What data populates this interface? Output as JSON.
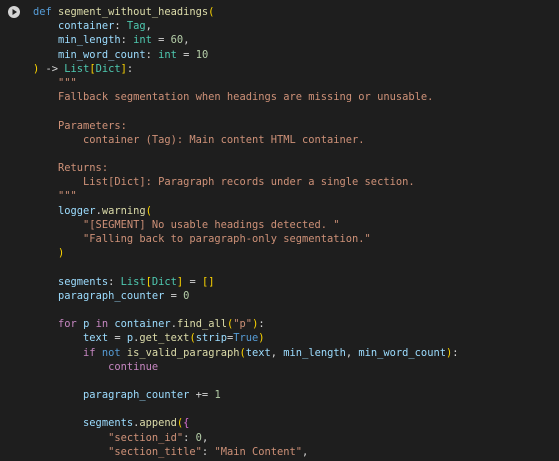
{
  "run_button": {
    "icon": "play-icon"
  },
  "code_lines": [
    [
      {
        "t": "def ",
        "c": "kw"
      },
      {
        "t": "segment_without_headings",
        "c": "fn"
      },
      {
        "t": "(",
        "c": "br1"
      }
    ],
    [
      {
        "t": "    "
      },
      {
        "t": "container",
        "c": "var"
      },
      {
        "t": ": "
      },
      {
        "t": "Tag",
        "c": "typ"
      },
      {
        "t": ","
      }
    ],
    [
      {
        "t": "    "
      },
      {
        "t": "min_length",
        "c": "var"
      },
      {
        "t": ": "
      },
      {
        "t": "int",
        "c": "typ"
      },
      {
        "t": " = "
      },
      {
        "t": "60",
        "c": "num"
      },
      {
        "t": ","
      }
    ],
    [
      {
        "t": "    "
      },
      {
        "t": "min_word_count",
        "c": "var"
      },
      {
        "t": ": "
      },
      {
        "t": "int",
        "c": "typ"
      },
      {
        "t": " = "
      },
      {
        "t": "10",
        "c": "num"
      }
    ],
    [
      {
        "t": ")",
        "c": "br1"
      },
      {
        "t": " -> "
      },
      {
        "t": "List",
        "c": "typ"
      },
      {
        "t": "[",
        "c": "br1"
      },
      {
        "t": "Dict",
        "c": "typ"
      },
      {
        "t": "]",
        "c": "br1"
      },
      {
        "t": ":"
      }
    ],
    [
      {
        "t": "    \"\"\"",
        "c": "str"
      }
    ],
    [
      {
        "t": "    Fallback segmentation when headings are missing or unusable.",
        "c": "str"
      }
    ],
    [
      {
        "t": ""
      }
    ],
    [
      {
        "t": "    Parameters:",
        "c": "str"
      }
    ],
    [
      {
        "t": "        container (Tag): Main content HTML container.",
        "c": "str"
      }
    ],
    [
      {
        "t": ""
      }
    ],
    [
      {
        "t": "    Returns:",
        "c": "str"
      }
    ],
    [
      {
        "t": "        List[Dict]: Paragraph records under a single section.",
        "c": "str"
      }
    ],
    [
      {
        "t": "    \"\"\"",
        "c": "str"
      }
    ],
    [
      {
        "t": "    "
      },
      {
        "t": "logger",
        "c": "var"
      },
      {
        "t": "."
      },
      {
        "t": "warning",
        "c": "fn"
      },
      {
        "t": "(",
        "c": "br1"
      }
    ],
    [
      {
        "t": "        \"[SEGMENT] No usable headings detected. \"",
        "c": "str"
      }
    ],
    [
      {
        "t": "        \"Falling back to paragraph-only segmentation.\"",
        "c": "str"
      }
    ],
    [
      {
        "t": "    "
      },
      {
        "t": ")",
        "c": "br1"
      }
    ],
    [
      {
        "t": ""
      }
    ],
    [
      {
        "t": "    "
      },
      {
        "t": "segments",
        "c": "var"
      },
      {
        "t": ": "
      },
      {
        "t": "List",
        "c": "typ"
      },
      {
        "t": "[",
        "c": "br1"
      },
      {
        "t": "Dict",
        "c": "typ"
      },
      {
        "t": "]",
        "c": "br1"
      },
      {
        "t": " = "
      },
      {
        "t": "[]",
        "c": "br1"
      }
    ],
    [
      {
        "t": "    "
      },
      {
        "t": "paragraph_counter",
        "c": "var"
      },
      {
        "t": " = "
      },
      {
        "t": "0",
        "c": "num"
      }
    ],
    [
      {
        "t": ""
      }
    ],
    [
      {
        "t": "    "
      },
      {
        "t": "for",
        "c": "kwc"
      },
      {
        "t": " "
      },
      {
        "t": "p",
        "c": "var"
      },
      {
        "t": " "
      },
      {
        "t": "in",
        "c": "kwc"
      },
      {
        "t": " "
      },
      {
        "t": "container",
        "c": "var"
      },
      {
        "t": "."
      },
      {
        "t": "find_all",
        "c": "fn"
      },
      {
        "t": "(",
        "c": "br1"
      },
      {
        "t": "\"p\"",
        "c": "str"
      },
      {
        "t": ")",
        "c": "br1"
      },
      {
        "t": ":"
      }
    ],
    [
      {
        "t": "        "
      },
      {
        "t": "text",
        "c": "var"
      },
      {
        "t": " = "
      },
      {
        "t": "p",
        "c": "var"
      },
      {
        "t": "."
      },
      {
        "t": "get_text",
        "c": "fn"
      },
      {
        "t": "(",
        "c": "br1"
      },
      {
        "t": "strip",
        "c": "var"
      },
      {
        "t": "="
      },
      {
        "t": "True",
        "c": "kw"
      },
      {
        "t": ")",
        "c": "br1"
      }
    ],
    [
      {
        "t": "        "
      },
      {
        "t": "if",
        "c": "kwc"
      },
      {
        "t": " "
      },
      {
        "t": "not",
        "c": "kw"
      },
      {
        "t": " "
      },
      {
        "t": "is_valid_paragraph",
        "c": "fn"
      },
      {
        "t": "(",
        "c": "br1"
      },
      {
        "t": "text",
        "c": "var"
      },
      {
        "t": ", "
      },
      {
        "t": "min_length",
        "c": "var"
      },
      {
        "t": ", "
      },
      {
        "t": "min_word_count",
        "c": "var"
      },
      {
        "t": ")",
        "c": "br1"
      },
      {
        "t": ":"
      }
    ],
    [
      {
        "t": "            "
      },
      {
        "t": "continue",
        "c": "kwc"
      }
    ],
    [
      {
        "t": ""
      }
    ],
    [
      {
        "t": "        "
      },
      {
        "t": "paragraph_counter",
        "c": "var"
      },
      {
        "t": " += "
      },
      {
        "t": "1",
        "c": "num"
      }
    ],
    [
      {
        "t": ""
      }
    ],
    [
      {
        "t": "        "
      },
      {
        "t": "segments",
        "c": "var"
      },
      {
        "t": "."
      },
      {
        "t": "append",
        "c": "fn"
      },
      {
        "t": "(",
        "c": "br1"
      },
      {
        "t": "{",
        "c": "br2"
      }
    ],
    [
      {
        "t": "            "
      },
      {
        "t": "\"section_id\"",
        "c": "str"
      },
      {
        "t": ": "
      },
      {
        "t": "0",
        "c": "num"
      },
      {
        "t": ","
      }
    ],
    [
      {
        "t": "            "
      },
      {
        "t": "\"section_title\"",
        "c": "str"
      },
      {
        "t": ": "
      },
      {
        "t": "\"Main Content\"",
        "c": "str"
      },
      {
        "t": ","
      }
    ]
  ]
}
